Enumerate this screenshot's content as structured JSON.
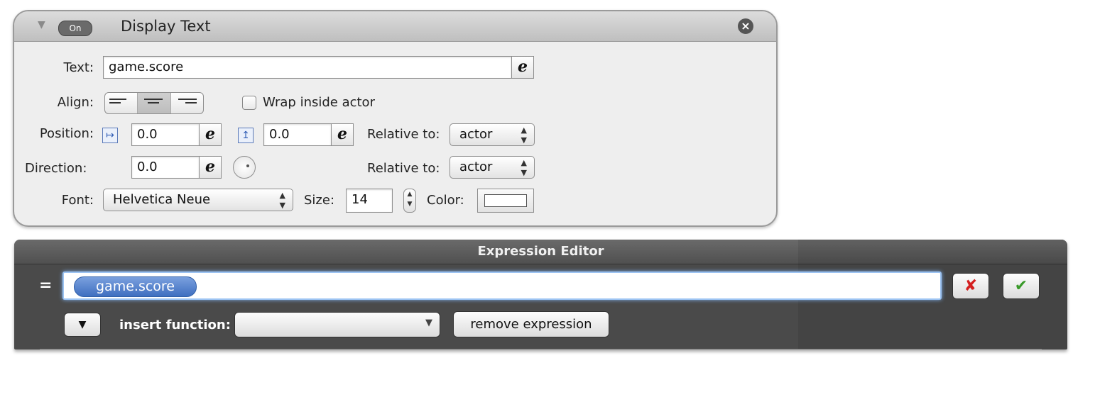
{
  "behavior": {
    "toggle_label": "On",
    "title": "Display Text",
    "text_label": "Text:",
    "text_value": "game.score",
    "expression_glyph": "e",
    "align_label": "Align:",
    "wrap_label": "Wrap inside actor",
    "wrap_checked": false,
    "position_label": "Position:",
    "position_x": "0.0",
    "position_y": "0.0",
    "relative_label": "Relative to:",
    "position_relative": "actor",
    "direction_label": "Direction:",
    "direction_value": "0.0",
    "direction_relative": "actor",
    "font_label": "Font:",
    "font_value": "Helvetica Neue",
    "size_label": "Size:",
    "size_value": "14",
    "color_label": "Color:",
    "color_value": "#ffffff",
    "align_selected": "center"
  },
  "editor": {
    "title": "Expression Editor",
    "equals": "=",
    "token": "game.score",
    "insert_label": "insert function:",
    "insert_value": "",
    "remove_label": "remove expression",
    "cancel_color": "#d42020",
    "confirm_color": "#3a9a2a"
  }
}
